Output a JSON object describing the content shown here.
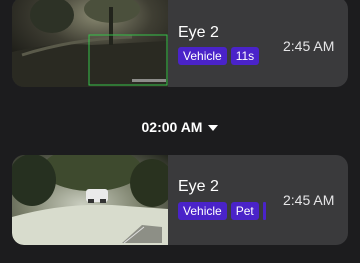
{
  "events": [
    {
      "camera": "Eye 2",
      "tags": [
        "Vehicle",
        "11s"
      ],
      "time": "2:45 AM",
      "has_more_tags": false
    },
    {
      "camera": "Eye 2",
      "tags": [
        "Vehicle",
        "Pet"
      ],
      "time": "2:45 AM",
      "has_more_tags": true
    }
  ],
  "hour_divider": {
    "label": "02:00 AM",
    "icon": "caret-down-icon"
  },
  "colors": {
    "background": "#1c1c1e",
    "card": "#3a3a3c",
    "tag": "#4a23c9",
    "detection_box": "#36c24a"
  }
}
